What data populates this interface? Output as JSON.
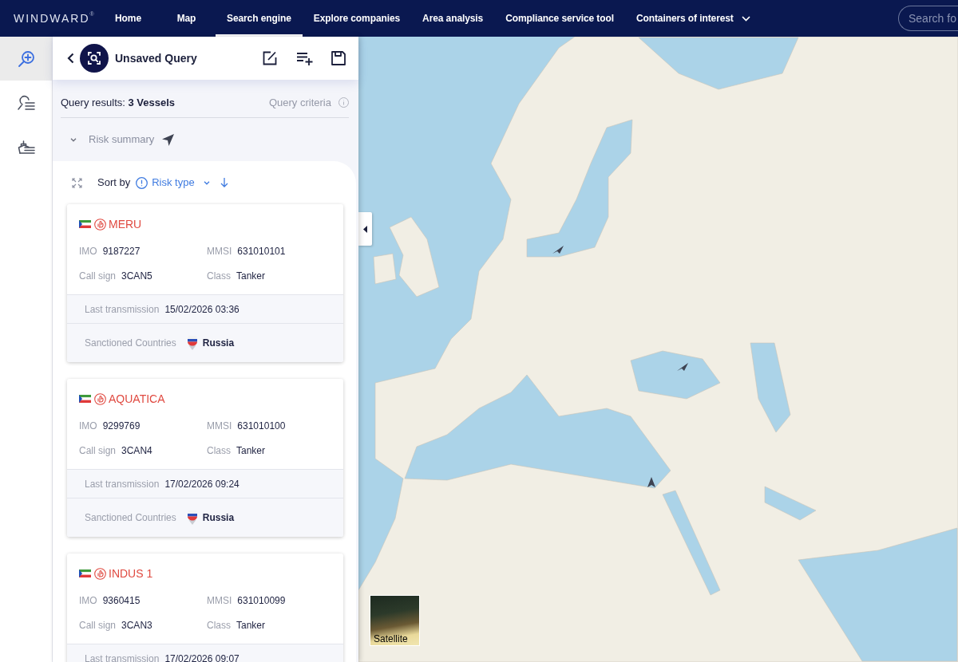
{
  "nav": {
    "logo": "WINDWARD",
    "logo_mark": "®",
    "items": [
      {
        "label": "Home",
        "selected": false,
        "kind": "link"
      },
      {
        "label": "Map",
        "selected": false,
        "kind": "link"
      },
      {
        "label": "Search engine",
        "selected": true,
        "kind": "link"
      },
      {
        "label": "Explore companies",
        "selected": false,
        "kind": "link"
      },
      {
        "label": "Area analysis",
        "selected": false,
        "kind": "link"
      },
      {
        "label": "Compliance service tool",
        "selected": false,
        "kind": "link"
      },
      {
        "label": "Containers of interest",
        "selected": false,
        "kind": "dropdown"
      }
    ],
    "search": {
      "placeholder": "Search fo"
    }
  },
  "rail": {
    "items": [
      {
        "selected": true
      },
      {
        "selected": false
      },
      {
        "selected": false
      }
    ]
  },
  "query_panel": {
    "title": "Unsaved Query",
    "results": "Query results: **3 Vessels**",
    "criteria": "Query criteria",
    "risk_summary": "Risk summary",
    "sort": {
      "label": "Sort by",
      "value": "Risk type"
    }
  },
  "vessels": [
    {
      "name": "MERU",
      "fields": [
        {
          "label": "IMO",
          "value": "9187227"
        },
        {
          "label": "MMSI",
          "value": "631010101"
        },
        {
          "label": "Call sign",
          "value": "3CAN5"
        },
        {
          "label": "Class",
          "value": "Tanker"
        }
      ],
      "details": [
        {
          "kind": "text",
          "label": "Last transmission",
          "value": "15/02/2026 03:36"
        },
        {
          "kind": "country",
          "label": "Sanctioned Countries",
          "value": "Russia"
        }
      ]
    },
    {
      "name": "AQUATICA",
      "fields": [
        {
          "label": "IMO",
          "value": "9299769"
        },
        {
          "label": "MMSI",
          "value": "631010100"
        },
        {
          "label": "Call sign",
          "value": "3CAN4"
        },
        {
          "label": "Class",
          "value": "Tanker"
        }
      ],
      "details": [
        {
          "kind": "text",
          "label": "Last transmission",
          "value": "17/02/2026 09:24"
        },
        {
          "kind": "country",
          "label": "Sanctioned Countries",
          "value": "Russia"
        }
      ]
    },
    {
      "name": "INDUS 1",
      "fields": [
        {
          "label": "IMO",
          "value": "9360415"
        },
        {
          "label": "MMSI",
          "value": "631010099"
        },
        {
          "label": "Call sign",
          "value": "3CAN3"
        },
        {
          "label": "Class",
          "value": "Tanker"
        }
      ],
      "details": [
        {
          "kind": "text",
          "label": "Last transmission",
          "value": "17/02/2026 09:07"
        }
      ]
    }
  ],
  "map": {
    "layer_toggle": "Satellite"
  }
}
